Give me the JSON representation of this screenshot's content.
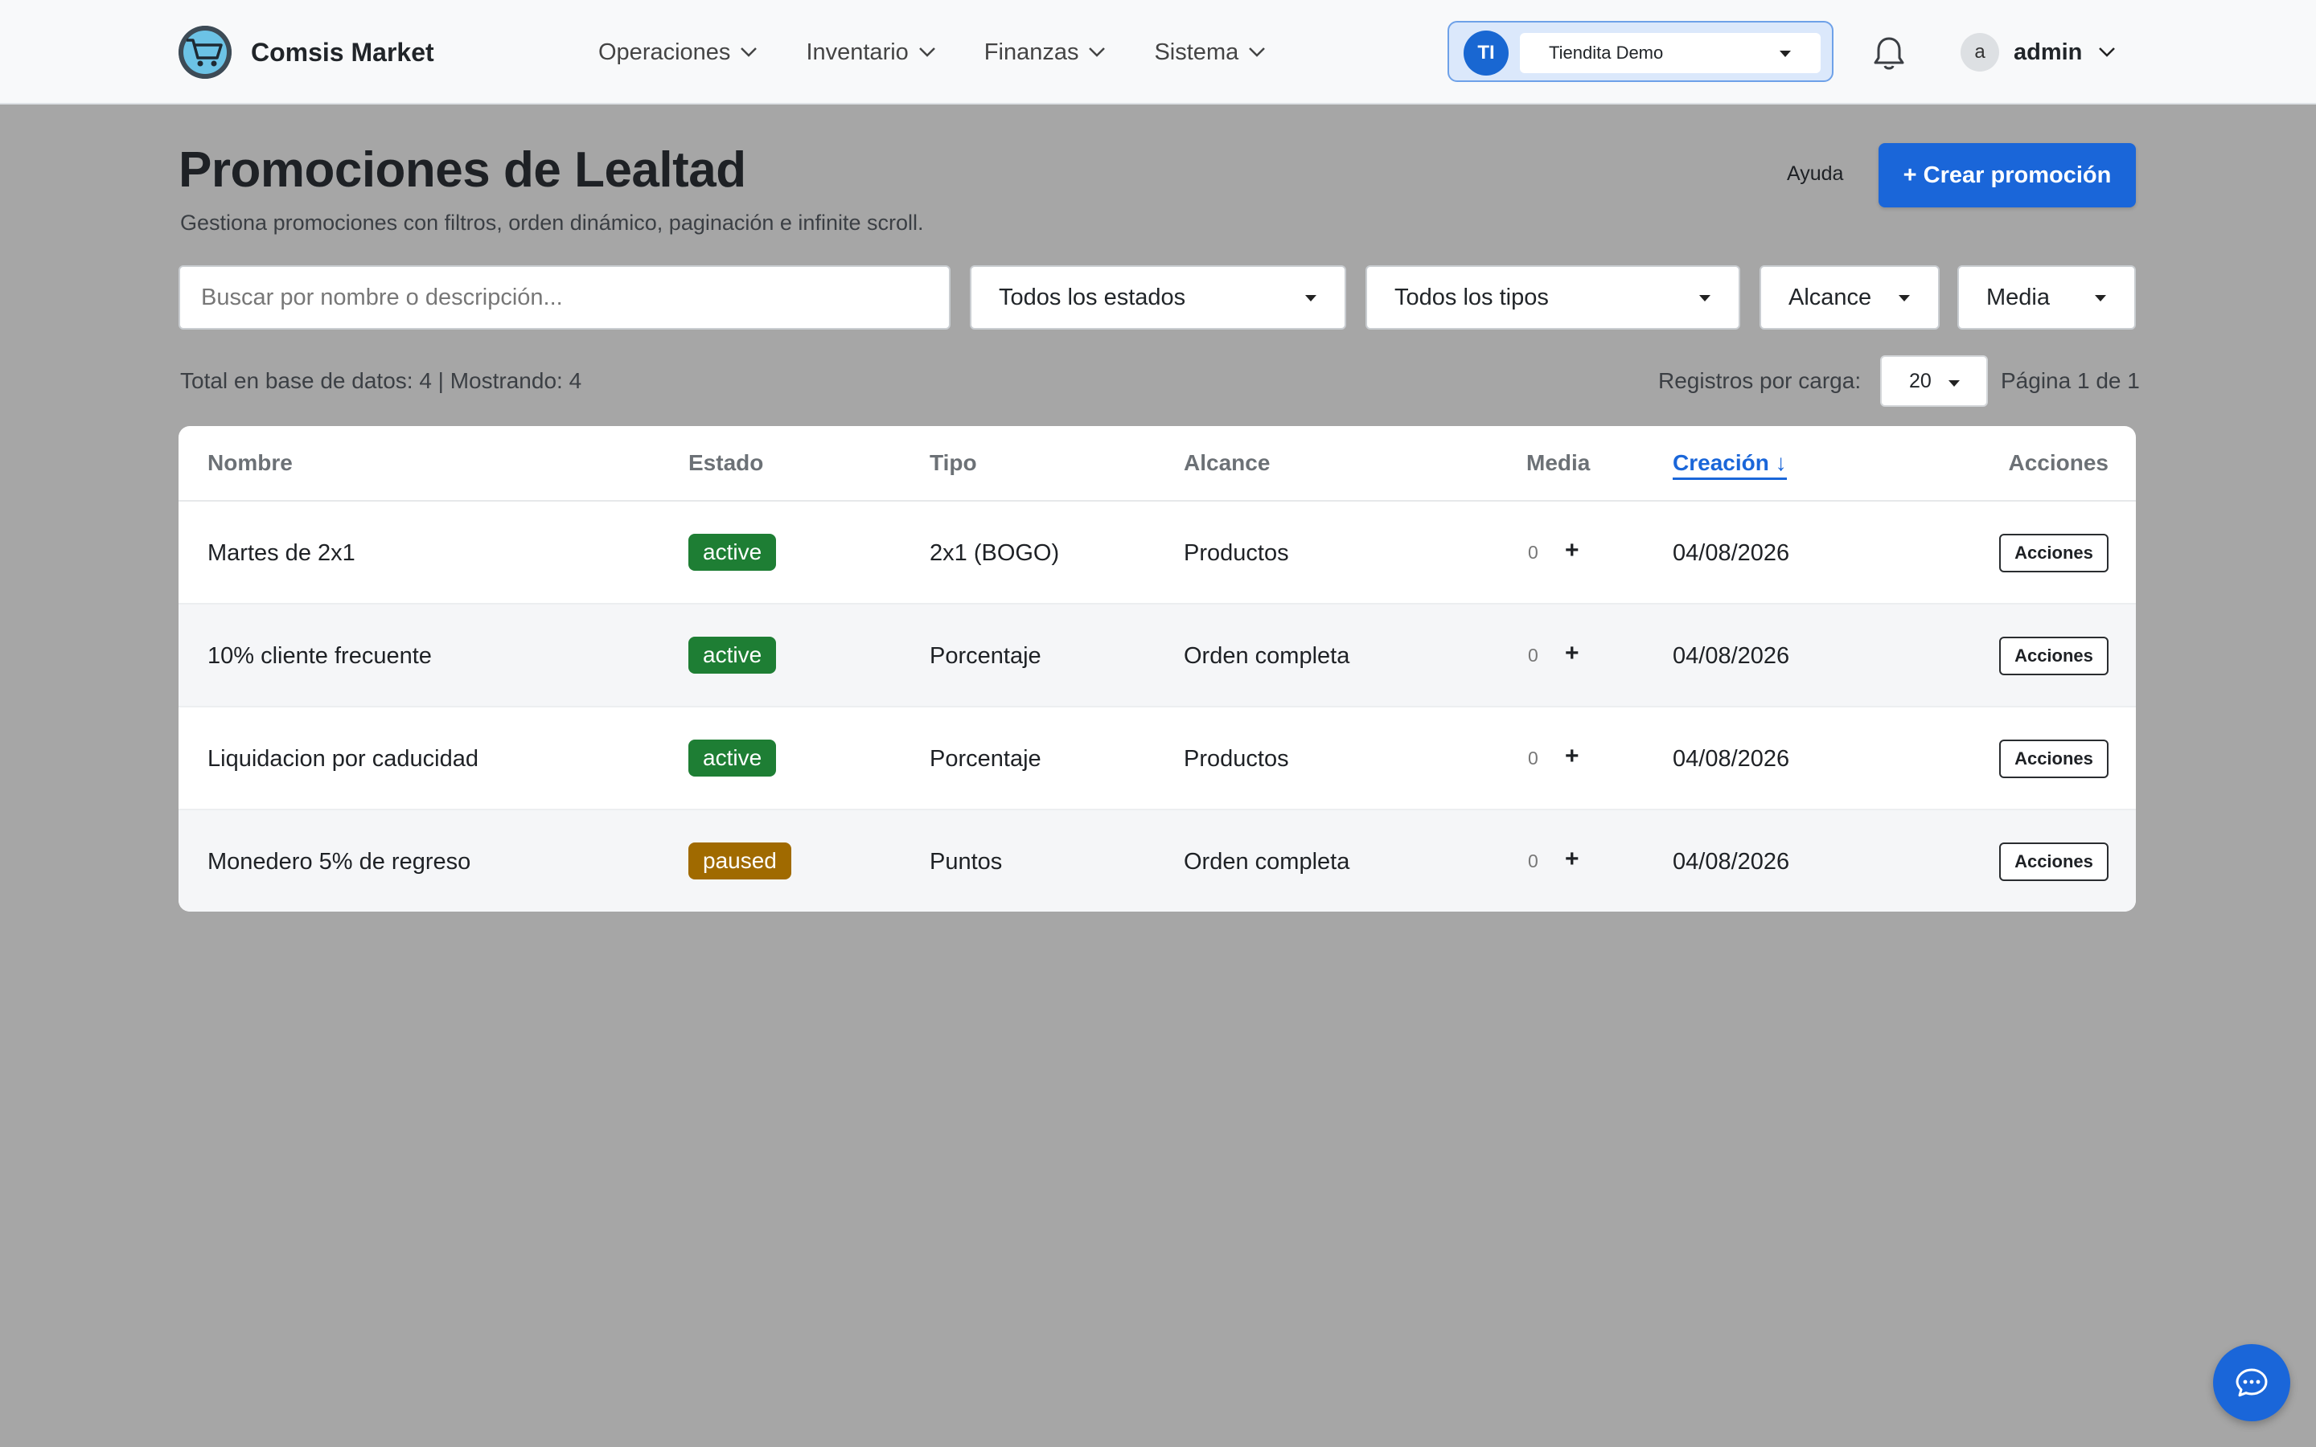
{
  "brand": {
    "name": "Comsis Market",
    "logo_icon": "shopping-cart-icon"
  },
  "nav": {
    "items": [
      {
        "label": "Operaciones"
      },
      {
        "label": "Inventario"
      },
      {
        "label": "Finanzas"
      },
      {
        "label": "Sistema"
      }
    ]
  },
  "store": {
    "initials": "TI",
    "name": "Tiendita Demo"
  },
  "user": {
    "initial": "a",
    "name": "admin"
  },
  "page": {
    "title": "Promociones de Lealtad",
    "subtitle": "Gestiona promociones con filtros, orden dinámico, paginación e infinite scroll.",
    "help_label": "Ayuda",
    "create_label": "+ Crear promoción"
  },
  "filters": {
    "search_placeholder": "Buscar por nombre o descripción...",
    "estado": "Todos los estados",
    "tipo": "Todos los tipos",
    "alcance": "Alcance",
    "media": "Media"
  },
  "summary": {
    "totals": "Total en base de datos: 4 | Mostrando: 4",
    "per_load_label": "Registros por carga:",
    "per_load_value": "20",
    "page_info": "Página 1 de 1"
  },
  "table": {
    "headers": {
      "nombre": "Nombre",
      "estado": "Estado",
      "tipo": "Tipo",
      "alcance": "Alcance",
      "media": "Media",
      "creacion": "Creación ↓",
      "acciones": "Acciones"
    },
    "rows": [
      {
        "nombre": "Martes de 2x1",
        "estado": "active",
        "tipo": "2x1 (BOGO)",
        "alcance": "Productos",
        "media_count": "0",
        "media_add": "+",
        "creacion": "04/08/2026",
        "accion": "Acciones"
      },
      {
        "nombre": "10% cliente frecuente",
        "estado": "active",
        "tipo": "Porcentaje",
        "alcance": "Orden completa",
        "media_count": "0",
        "media_add": "+",
        "creacion": "04/08/2026",
        "accion": "Acciones"
      },
      {
        "nombre": "Liquidacion por caducidad",
        "estado": "active",
        "tipo": "Porcentaje",
        "alcance": "Productos",
        "media_count": "0",
        "media_add": "+",
        "creacion": "04/08/2026",
        "accion": "Acciones"
      },
      {
        "nombre": "Monedero 5% de regreso",
        "estado": "paused",
        "tipo": "Puntos",
        "alcance": "Orden completa",
        "media_count": "0",
        "media_add": "+",
        "creacion": "04/08/2026",
        "accion": "Acciones"
      }
    ]
  },
  "colors": {
    "primary": "#1a66d9",
    "status_active": "#1e7e34",
    "status_paused": "#a06a00",
    "overlay": "#a6a6a6"
  },
  "chat": {
    "icon": "chat-bubble-icon"
  }
}
